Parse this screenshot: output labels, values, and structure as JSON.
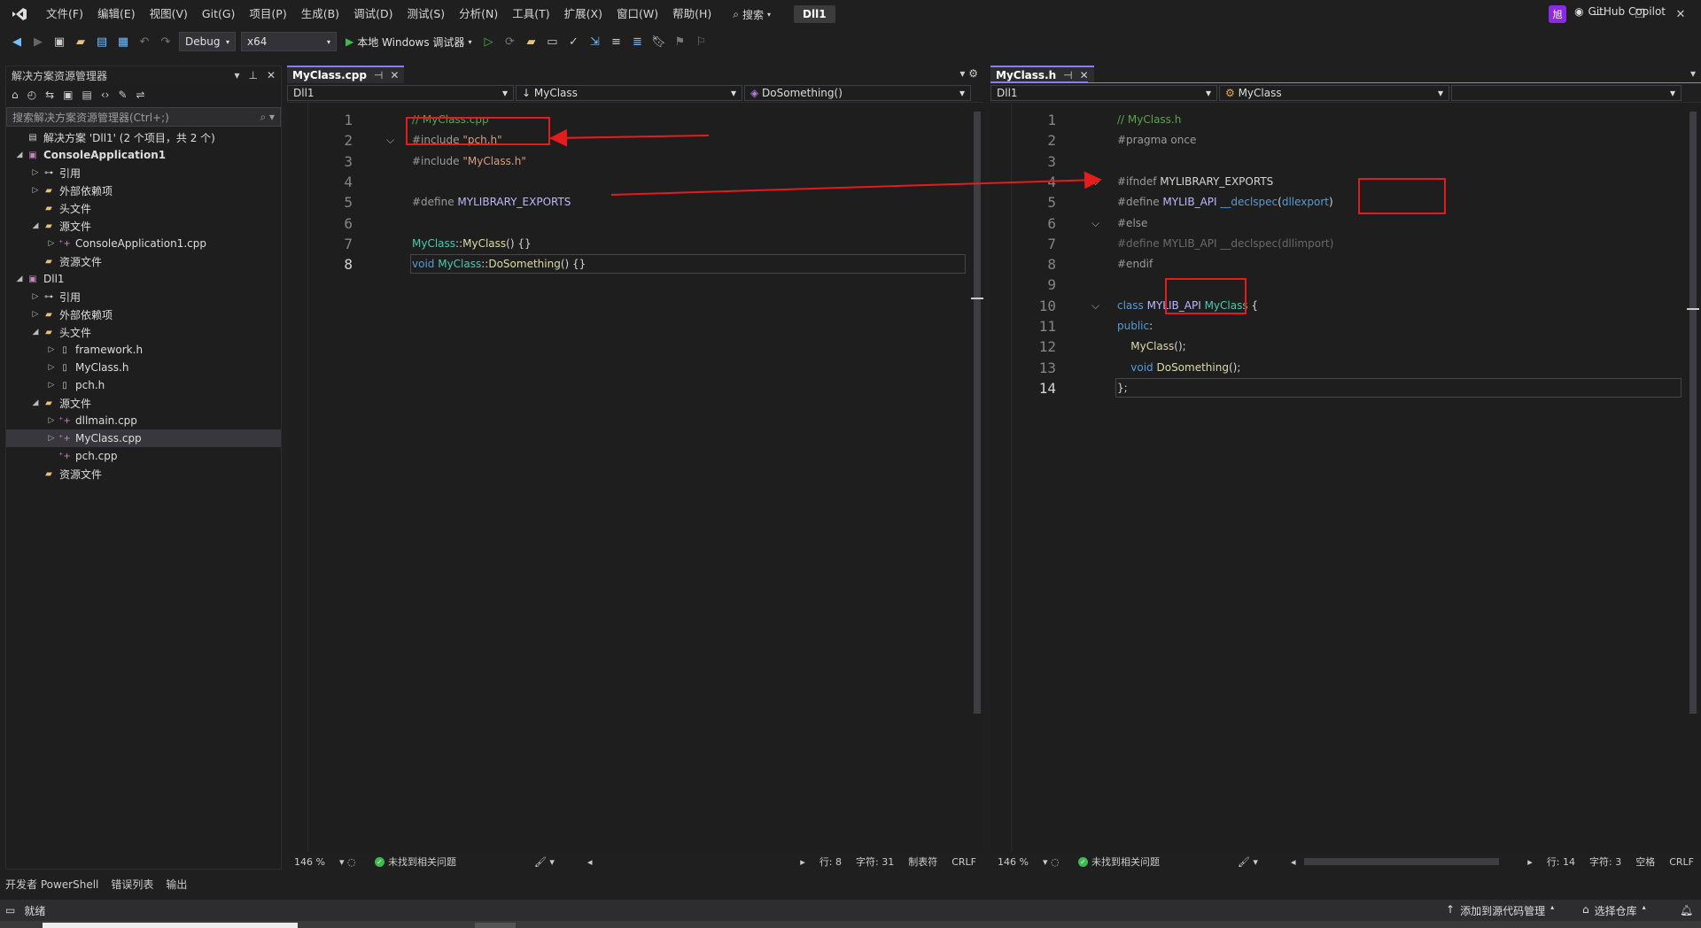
{
  "title_bar": {
    "menus": [
      "文件(F)",
      "编辑(E)",
      "视图(V)",
      "Git(G)",
      "项目(P)",
      "生成(B)",
      "调试(D)",
      "测试(S)",
      "分析(N)",
      "工具(T)",
      "扩展(X)",
      "窗口(W)",
      "帮助(H)"
    ],
    "search_label": "搜索",
    "solution_name": "Dll1",
    "avatar_initial": "旭"
  },
  "toolbar": {
    "configuration": "Debug",
    "platform": "x64",
    "run_label": "本地 Windows 调试器",
    "copilot_label": "GitHub Copilot"
  },
  "solution_explorer": {
    "title": "解决方案资源管理器",
    "search_placeholder": "搜索解决方案资源管理器(Ctrl+;)",
    "tree": [
      {
        "label": "解决方案 'Dll1' (2 个项目，共 2 个)",
        "level": 0,
        "twisty": "",
        "icon": "solution-icon",
        "bold": false
      },
      {
        "label": "ConsoleApplication1",
        "level": 0,
        "twisty": "◢",
        "icon": "project-icon",
        "bold": true
      },
      {
        "label": "引用",
        "level": 1,
        "twisty": "▷",
        "icon": "references-icon",
        "bold": false
      },
      {
        "label": "外部依赖项",
        "level": 1,
        "twisty": "▷",
        "icon": "filter-icon",
        "bold": false
      },
      {
        "label": "头文件",
        "level": 1,
        "twisty": "",
        "icon": "folder-icon",
        "bold": false
      },
      {
        "label": "源文件",
        "level": 1,
        "twisty": "◢",
        "icon": "folder-icon",
        "bold": false
      },
      {
        "label": "ConsoleApplication1.cpp",
        "level": 2,
        "twisty": "▷",
        "icon": "cpp-file-icon",
        "bold": false
      },
      {
        "label": "资源文件",
        "level": 1,
        "twisty": "",
        "icon": "folder-icon",
        "bold": false
      },
      {
        "label": "Dll1",
        "level": 0,
        "twisty": "◢",
        "icon": "project-icon",
        "bold": false
      },
      {
        "label": "引用",
        "level": 1,
        "twisty": "▷",
        "icon": "references-icon",
        "bold": false
      },
      {
        "label": "外部依赖项",
        "level": 1,
        "twisty": "▷",
        "icon": "filter-icon",
        "bold": false
      },
      {
        "label": "头文件",
        "level": 1,
        "twisty": "◢",
        "icon": "folder-icon",
        "bold": false
      },
      {
        "label": "framework.h",
        "level": 2,
        "twisty": "▷",
        "icon": "header-file-icon",
        "bold": false
      },
      {
        "label": "MyClass.h",
        "level": 2,
        "twisty": "▷",
        "icon": "header-file-icon",
        "bold": false
      },
      {
        "label": "pch.h",
        "level": 2,
        "twisty": "▷",
        "icon": "header-file-icon",
        "bold": false
      },
      {
        "label": "源文件",
        "level": 1,
        "twisty": "◢",
        "icon": "folder-icon",
        "bold": false
      },
      {
        "label": "dllmain.cpp",
        "level": 2,
        "twisty": "▷",
        "icon": "cpp-file-icon",
        "bold": false
      },
      {
        "label": "MyClass.cpp",
        "level": 2,
        "twisty": "▷",
        "icon": "cpp-file-icon",
        "bold": false,
        "selected": true
      },
      {
        "label": "pch.cpp",
        "level": 2,
        "twisty": "",
        "icon": "cpp-file-icon",
        "bold": false
      },
      {
        "label": "资源文件",
        "level": 1,
        "twisty": "",
        "icon": "folder-icon",
        "bold": false
      }
    ]
  },
  "left_editor": {
    "tab": "MyClass.cpp",
    "nav": [
      "Dll1",
      "MyClass",
      "DoSomething()"
    ],
    "current_line": 8,
    "lines": [
      [
        {
          "t": "// MyClass.cpp",
          "c": "c-cmt"
        }
      ],
      [
        {
          "t": "#include ",
          "c": "c-pp"
        },
        {
          "t": "\"pch.h\"",
          "c": "c-str"
        }
      ],
      [
        {
          "t": "#include ",
          "c": "c-pp"
        },
        {
          "t": "\"MyClass.h\"",
          "c": "c-str"
        }
      ],
      [],
      [
        {
          "t": "#define ",
          "c": "c-pp"
        },
        {
          "t": "MYLIBRARY_EXPORTS",
          "c": "c-mac"
        }
      ],
      [],
      [
        {
          "t": "MyClass",
          "c": "c-cls"
        },
        {
          "t": "::",
          "c": "c-txt"
        },
        {
          "t": "MyClass",
          "c": "c-fn"
        },
        {
          "t": "() {}",
          "c": "c-txt"
        }
      ],
      [
        {
          "t": "void ",
          "c": "c-kw"
        },
        {
          "t": "MyClass",
          "c": "c-cls"
        },
        {
          "t": "::",
          "c": "c-txt"
        },
        {
          "t": "DoSomething",
          "c": "c-fn"
        },
        {
          "t": "() {}",
          "c": "c-txt"
        }
      ]
    ],
    "status": {
      "zoom": "146 %",
      "issues": "未找到相关问题",
      "line": "行: 8",
      "col": "字符: 31",
      "tabs": "制表符",
      "eol": "CRLF"
    }
  },
  "right_editor": {
    "tab": "MyClass.h",
    "nav": [
      "Dll1",
      "MyClass",
      ""
    ],
    "current_line": 14,
    "lines": [
      [
        {
          "t": "// MyClass.h",
          "c": "c-cmt"
        }
      ],
      [
        {
          "t": "#pragma once",
          "c": "c-pp"
        }
      ],
      [],
      [
        {
          "t": "#ifndef ",
          "c": "c-pp"
        },
        {
          "t": "MYLIBRARY_EXPORTS",
          "c": "c-txt"
        }
      ],
      [
        {
          "t": "#define ",
          "c": "c-pp"
        },
        {
          "t": "MYLIB_API ",
          "c": "c-mac"
        },
        {
          "t": "__declspec",
          "c": "c-kw"
        },
        {
          "t": "(",
          "c": "c-txt"
        },
        {
          "t": "dllexport",
          "c": "c-kw"
        },
        {
          "t": ")",
          "c": "c-txt"
        }
      ],
      [
        {
          "t": "#else",
          "c": "c-pp"
        }
      ],
      [
        {
          "t": "#define MYLIB_API __declspec(dllimport)",
          "c": "c-dim"
        }
      ],
      [
        {
          "t": "#endif",
          "c": "c-pp"
        }
      ],
      [],
      [
        {
          "t": "class ",
          "c": "c-kw"
        },
        {
          "t": "MYLIB_API",
          "c": "c-mac"
        },
        {
          "t": " ",
          "c": "c-txt"
        },
        {
          "t": "MyClass",
          "c": "c-cls"
        },
        {
          "t": " {",
          "c": "c-txt"
        }
      ],
      [
        {
          "t": "public",
          "c": "c-kw"
        },
        {
          "t": ":",
          "c": "c-txt"
        }
      ],
      [
        {
          "t": "    ",
          "c": "c-txt"
        },
        {
          "t": "MyClass",
          "c": "c-fn"
        },
        {
          "t": "();",
          "c": "c-txt"
        }
      ],
      [
        {
          "t": "    ",
          "c": "c-txt"
        },
        {
          "t": "void ",
          "c": "c-kw"
        },
        {
          "t": "DoSomething",
          "c": "c-fn"
        },
        {
          "t": "();",
          "c": "c-txt"
        }
      ],
      [
        {
          "t": "};",
          "c": "c-txt"
        }
      ]
    ],
    "status": {
      "zoom": "146 %",
      "issues": "未找到相关问题",
      "line": "行: 14",
      "col": "字符: 3",
      "tabs": "空格",
      "eol": "CRLF"
    }
  },
  "bottom_tabs": [
    "开发者 PowerShell",
    "错误列表",
    "输出"
  ],
  "status_bar": {
    "ready": "就绪",
    "add_source": "添加到源代码管理",
    "select_repo": "选择仓库"
  },
  "colors": {
    "accent": "#8b7cf6",
    "annotation_red": "#e51c1c"
  }
}
